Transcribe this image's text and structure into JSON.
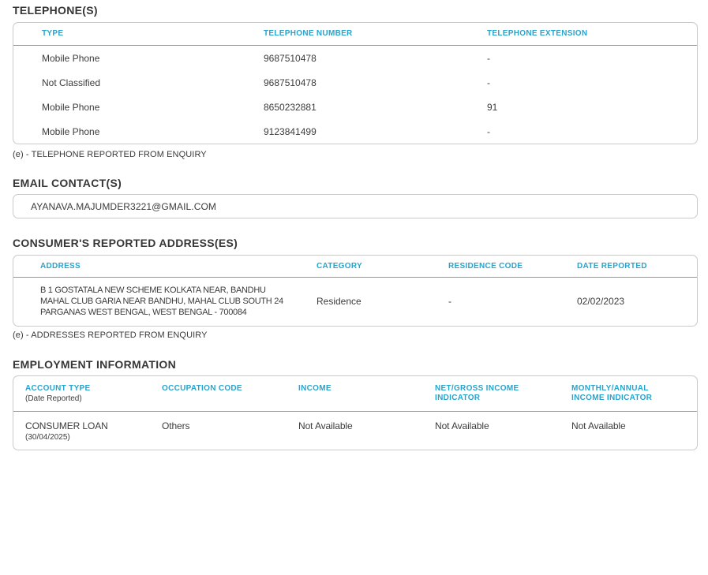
{
  "colors": {
    "accent_teal": "#27A4CD",
    "text_dark": "#3C3C3C",
    "card_border": "#CACACA"
  },
  "telephones": {
    "title": "TELEPHONE(S)",
    "columns": [
      "TYPE",
      "TELEPHONE NUMBER",
      "TELEPHONE EXTENSION"
    ],
    "rows": [
      {
        "type": "Mobile Phone",
        "number": "9687510478",
        "extension": "-"
      },
      {
        "type": "Not Classified",
        "number": "9687510478",
        "extension": "-"
      },
      {
        "type": "Mobile Phone",
        "number": "8650232881",
        "extension": "91"
      },
      {
        "type": "Mobile Phone",
        "number": "9123841499",
        "extension": "-"
      }
    ],
    "footnote": "(e) - TELEPHONE REPORTED FROM ENQUIRY"
  },
  "emails": {
    "title": "EMAIL CONTACT(S)",
    "items": [
      "AYANAVA.MAJUMDER3221@GMAIL.COM"
    ]
  },
  "addresses": {
    "title": "CONSUMER'S REPORTED ADDRESS(ES)",
    "columns": [
      "ADDRESS",
      "CATEGORY",
      "RESIDENCE CODE",
      "DATE REPORTED"
    ],
    "rows": [
      {
        "address_lines": [
          "B 1 GOSTATALA NEW SCHEME KOLKATA NEAR, BANDHU",
          "MAHAL CLUB GARIA NEAR BANDHU, MAHAL CLUB SOUTH 24",
          "PARGANAS WEST BENGAL, WEST BENGAL - 700084"
        ],
        "category": "Residence",
        "residence_code": "-",
        "date_reported": "02/02/2023"
      }
    ],
    "footnote": "(e) - ADDRESSES REPORTED FROM ENQUIRY"
  },
  "employment": {
    "title": "EMPLOYMENT INFORMATION",
    "columns": [
      "ACCOUNT TYPE",
      "OCCUPATION CODE",
      "INCOME",
      "NET/GROSS INCOME INDICATOR",
      "MONTHLY/ANNUAL INCOME INDICATOR"
    ],
    "column_subtitle": "(Date Reported)",
    "rows": [
      {
        "account_type": "CONSUMER LOAN",
        "date_reported": "(30/04/2025)",
        "occupation_code": "Others",
        "income": "Not Available",
        "net_gross_indicator": "Not Available",
        "monthly_annual_indicator": "Not Available"
      }
    ]
  }
}
